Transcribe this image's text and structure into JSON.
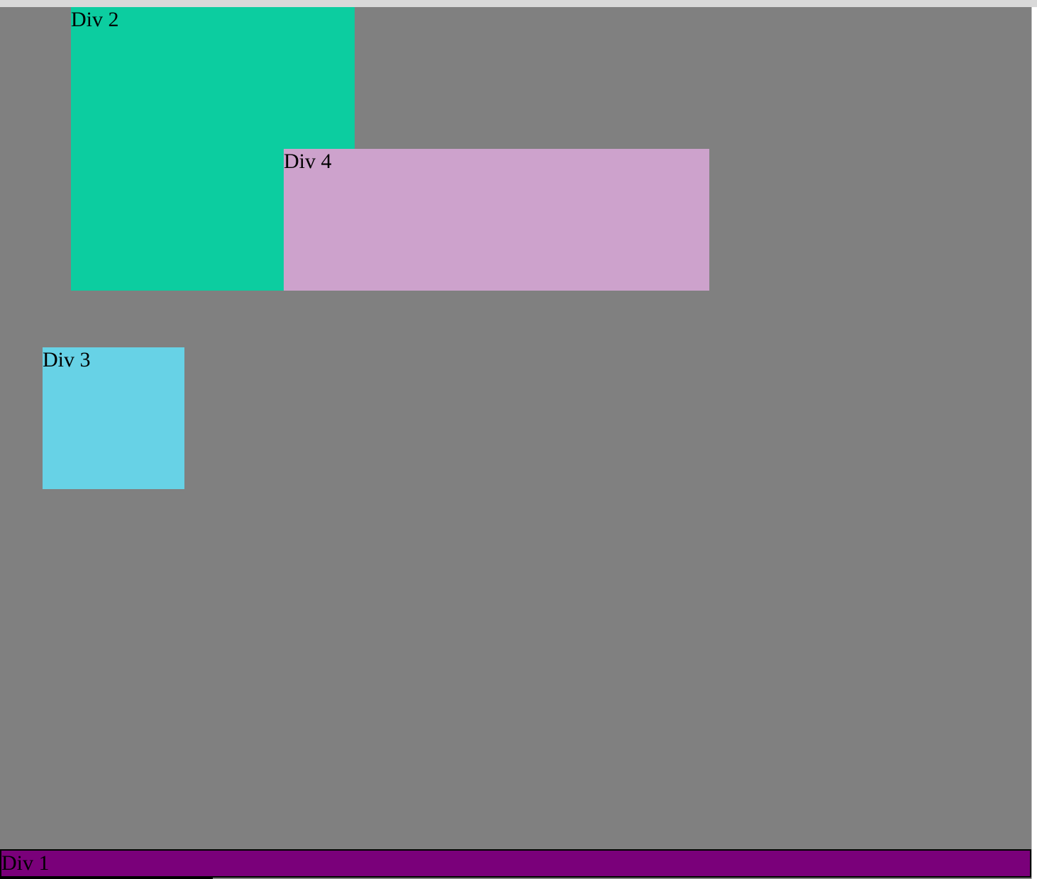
{
  "boxes": {
    "div1": {
      "label": "Div 1",
      "color": "#7a007a"
    },
    "div2": {
      "label": "Div 2",
      "color": "#0ccda0"
    },
    "div3": {
      "label": "Div 3",
      "color": "#67d2e6"
    },
    "div4": {
      "label": "Div 4",
      "color": "#cda2cc"
    }
  },
  "colors": {
    "page_background": "#808080",
    "top_bar": "#d9d9d9"
  }
}
